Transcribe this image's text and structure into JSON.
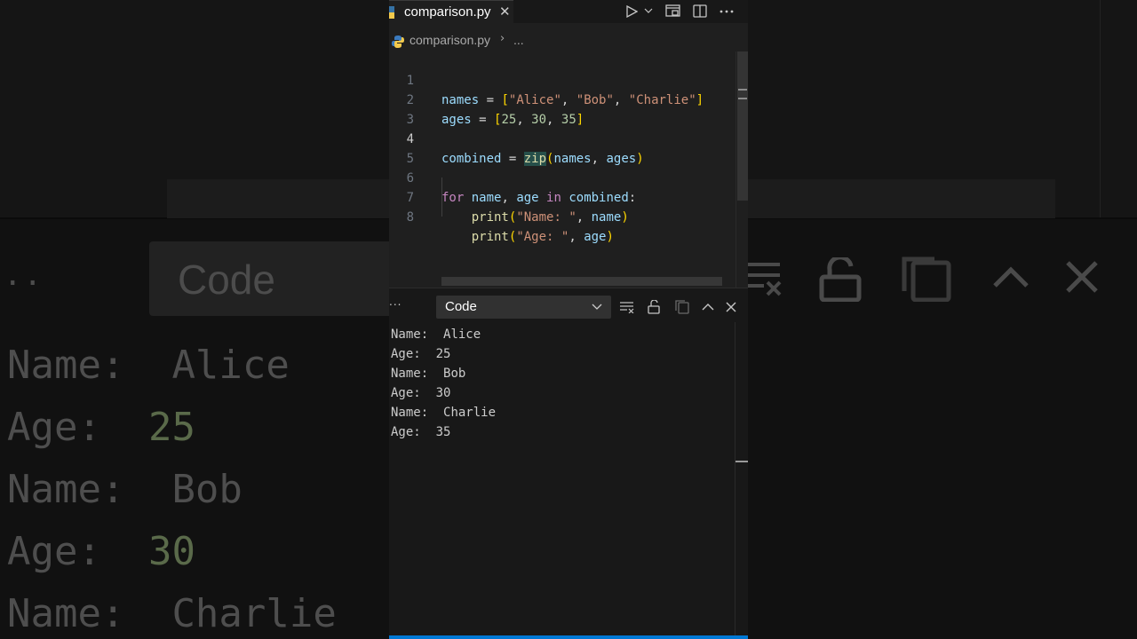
{
  "background": {
    "dropdown_label": "Code",
    "dots": "..",
    "lines": [
      {
        "label": "Name:",
        "value": "Alice"
      },
      {
        "label": "Age:",
        "value": "25"
      },
      {
        "label": "Name:",
        "value": "Bob"
      },
      {
        "label": "Age:",
        "value": "30"
      },
      {
        "label": "Name:",
        "value": "Charlie"
      }
    ]
  },
  "tab": {
    "label": "comparison.py",
    "close_glyph": "✕",
    "icon": "python-icon"
  },
  "toolbar": {
    "icons": [
      "run-icon",
      "run-dropdown-icon",
      "open-preview-icon",
      "split-editor-icon",
      "more-actions-icon"
    ]
  },
  "breadcrumb": {
    "file": "comparison.py",
    "separator": "›",
    "more": "..."
  },
  "editor": {
    "active_line": 4,
    "line_numbers": [
      "1",
      "2",
      "3",
      "4",
      "5",
      "6",
      "7",
      "8"
    ],
    "lines": [
      "names = [\"Alice\", \"Bob\", \"Charlie\"]",
      "ages = [25, 30, 35]",
      "",
      "combined = zip(names, ages)",
      "",
      "for name, age in combined:",
      "    print(\"Name: \", name)",
      "    print(\"Age: \", age)"
    ]
  },
  "panel": {
    "more_glyph": "...",
    "channel": "Code",
    "icons": [
      "clear-output-icon",
      "lock-scroll-icon",
      "copy-icon",
      "maximize-panel-icon",
      "close-panel-icon"
    ],
    "output": [
      {
        "label": "Name: ",
        "value": "Alice"
      },
      {
        "label": "Age: ",
        "value": "25"
      },
      {
        "label": "Name: ",
        "value": "Bob"
      },
      {
        "label": "Age: ",
        "value": "30"
      },
      {
        "label": "Name: ",
        "value": "Charlie"
      },
      {
        "label": "Age: ",
        "value": "35"
      }
    ]
  },
  "colors": {
    "editor_bg": "#1f1f1f",
    "panel_bg": "#181818",
    "accent": "#0078d4",
    "variable": "#9cdcfe",
    "string": "#ce9178",
    "number": "#b5cea8",
    "keyword": "#c586c0",
    "function": "#dcdcaa"
  }
}
